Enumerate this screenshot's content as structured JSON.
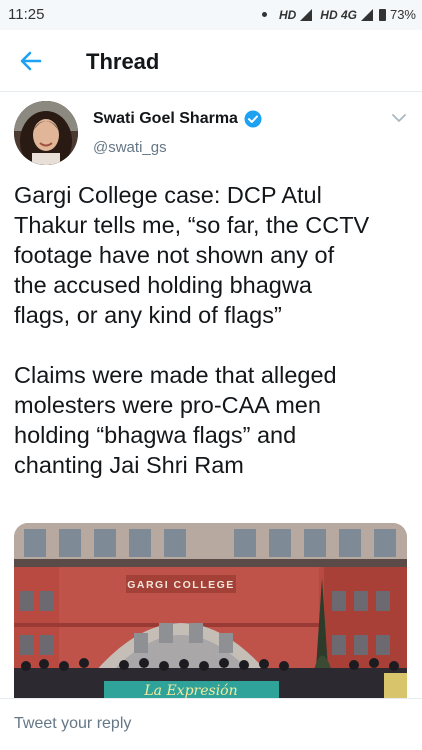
{
  "status_bar": {
    "time": "11:25",
    "net1": "HD",
    "net2": "HD 4G",
    "battery": "73%"
  },
  "header": {
    "title": "Thread",
    "back_icon": "arrow-left-icon"
  },
  "tweet": {
    "author_name": "Swati Goel Sharma",
    "author_handle": "@swati_gs",
    "paragraph_1": "Gargi College case: DCP Atul\nThakur tells me, “so far, the CCTV\nfootage have not shown any of\nthe accused holding bhagwa\nflags, or any kind of flags”",
    "paragraph_2": "Claims were made that alleged\nmolesters were pro-CAA men\nholding “bhagwa flags” and\nchanting Jai Shri Ram",
    "image_sign": "GARGI COLLEGE",
    "banner_text": "La Expresión"
  },
  "reply": {
    "placeholder": "Tweet your reply"
  },
  "colors": {
    "accent": "#1da1f2",
    "text": "#14171a",
    "muted": "#657786"
  }
}
